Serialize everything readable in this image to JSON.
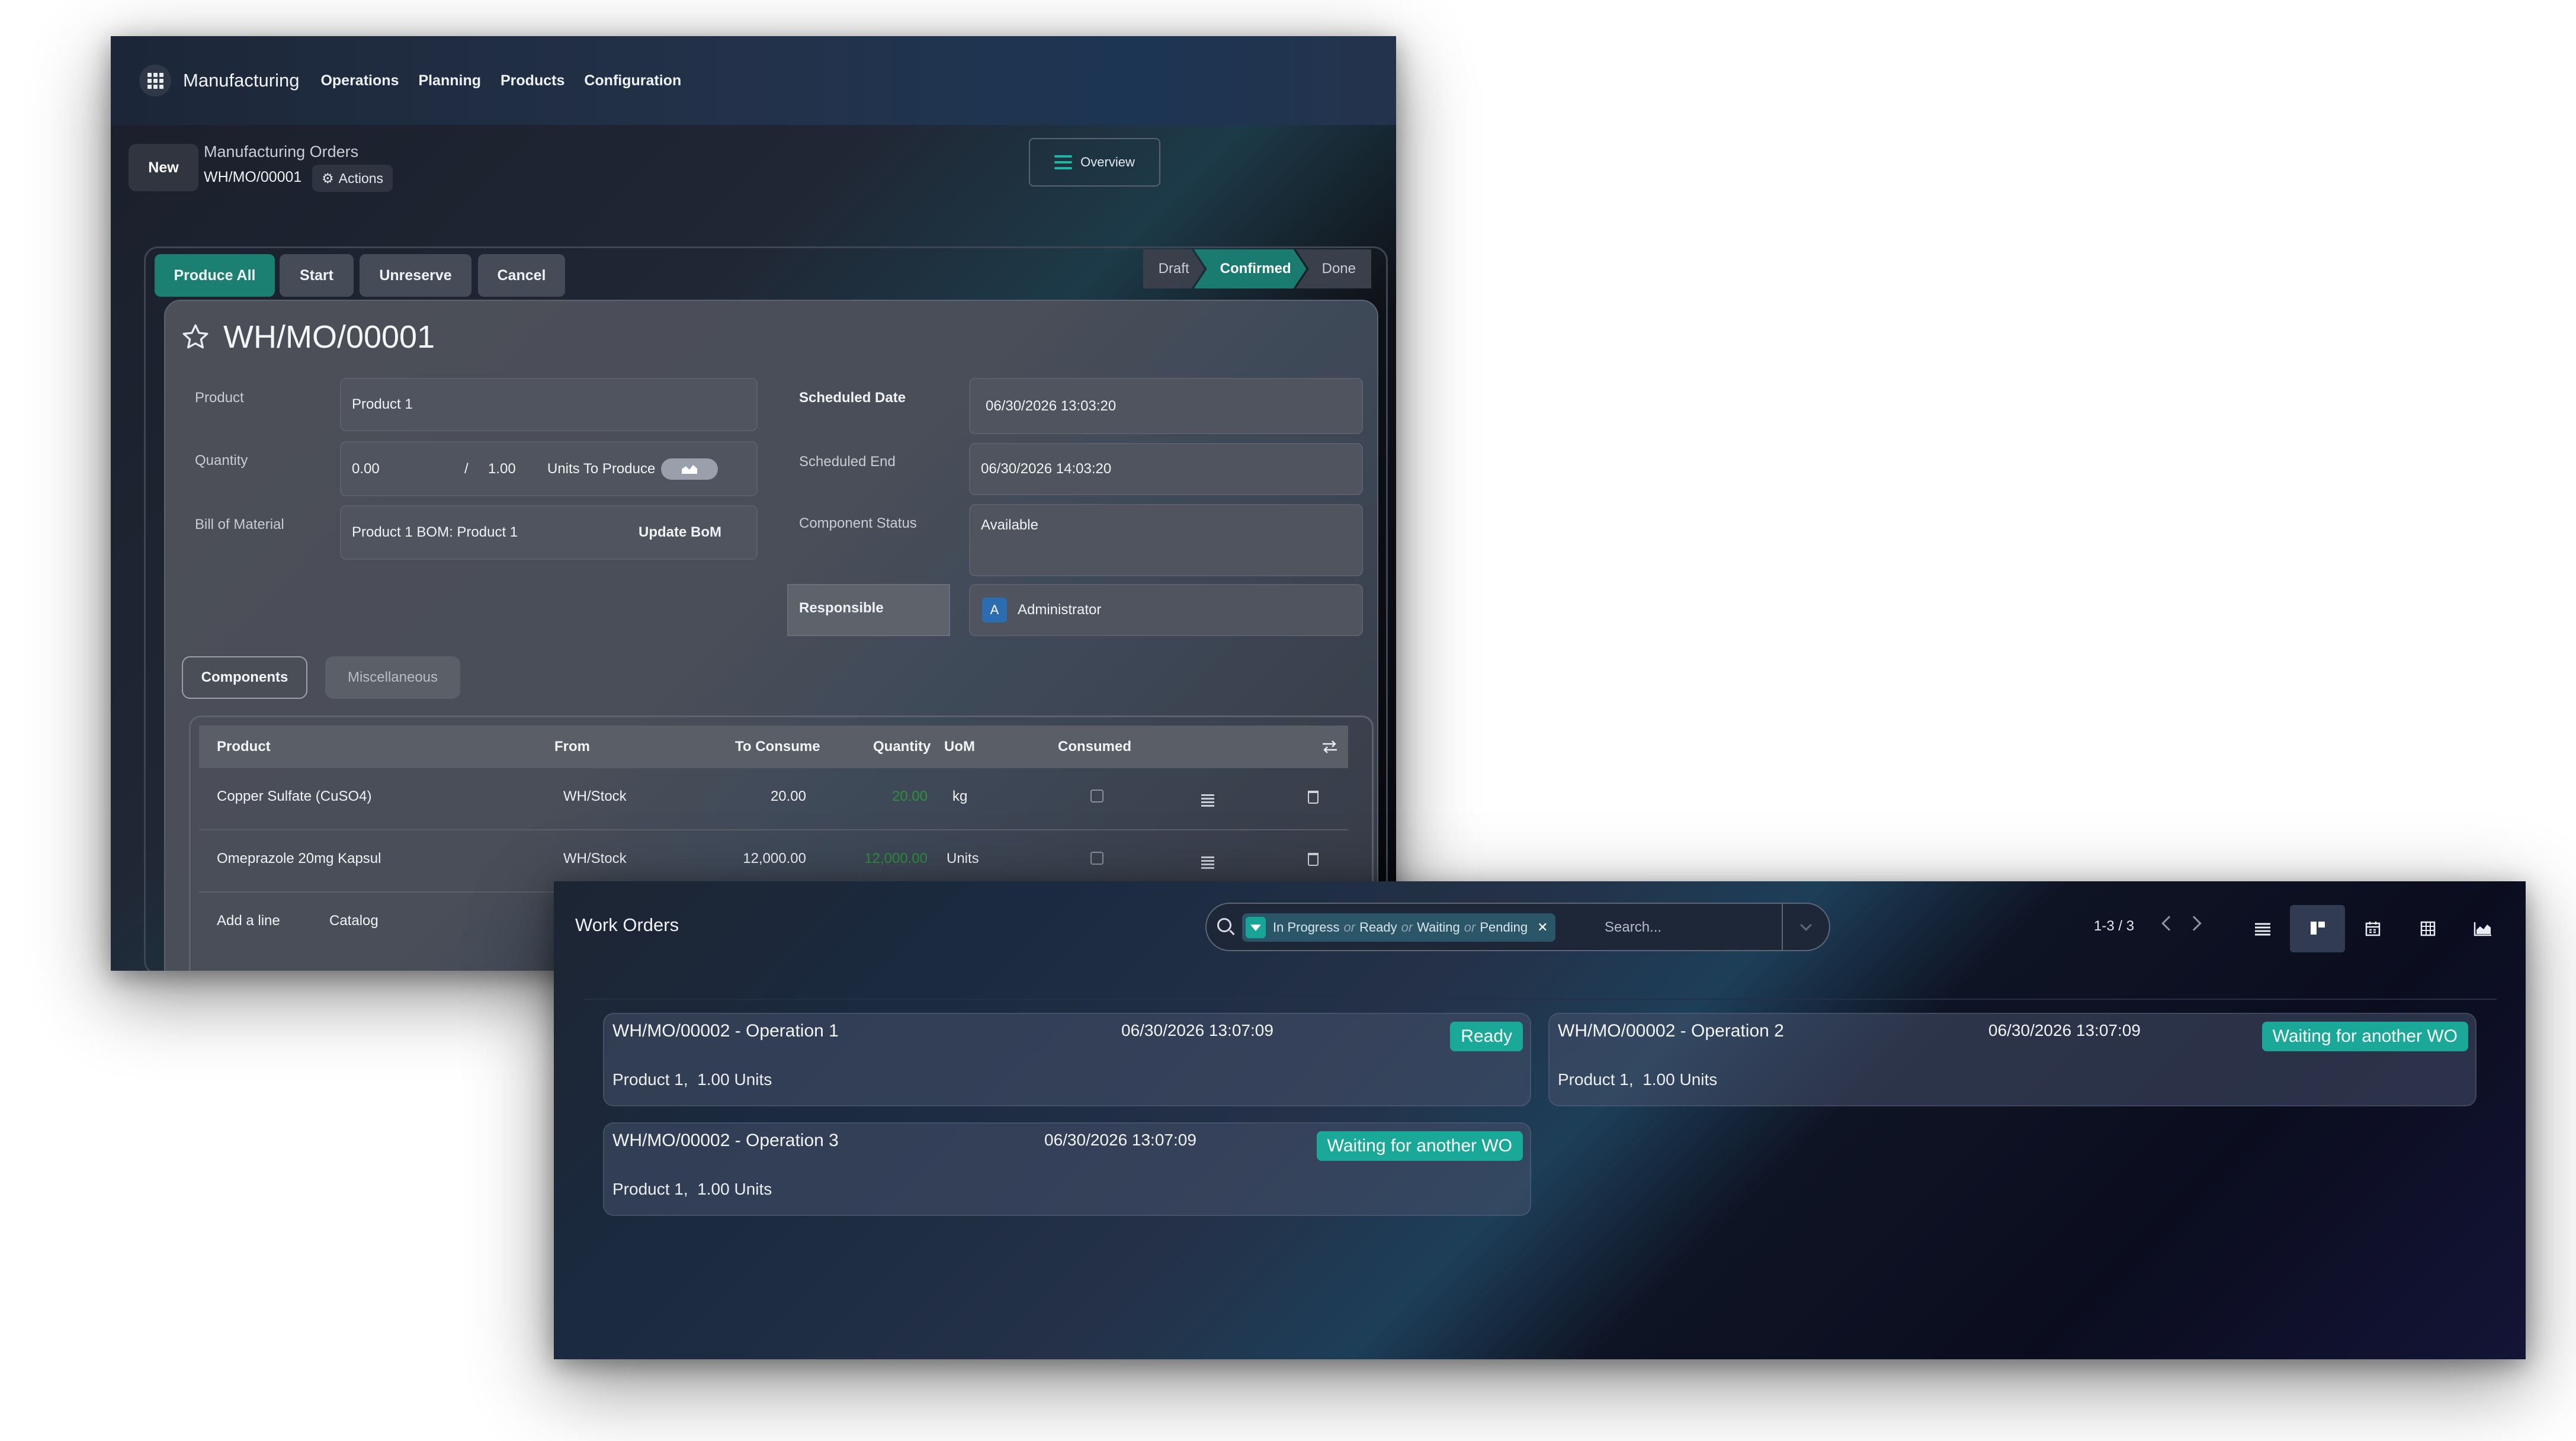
{
  "manufacturing": {
    "topbar": {
      "app_name": "Manufacturing",
      "nav": [
        "Operations",
        "Planning",
        "Products",
        "Configuration"
      ]
    },
    "control": {
      "new_label": "New",
      "breadcrumb": "Manufacturing Orders",
      "record": "WH/MO/00001",
      "actions_label": "Actions",
      "overview_label": "Overview"
    },
    "status_buttons": [
      "Produce All",
      "Start",
      "Unreserve",
      "Cancel"
    ],
    "stages": [
      "Draft",
      "Confirmed",
      "Done"
    ],
    "active_stage": "Confirmed",
    "title": "WH/MO/00001",
    "fields": {
      "product_label": "Product",
      "product_value": "Product 1",
      "quantity_label": "Quantity",
      "quantity_done": "0.00",
      "quantity_sep": "/",
      "quantity_total": "1.00",
      "quantity_unit": "Units To Produce",
      "bom_label": "Bill of Material",
      "bom_value": "Product 1 BOM: Product 1",
      "update_bom_label": "Update BoM",
      "scheduled_date_label": "Scheduled Date",
      "scheduled_date_value": "06/30/2026 13:03:20",
      "scheduled_end_label": "Scheduled End",
      "scheduled_end_value": "06/30/2026 14:03:20",
      "component_status_label": "Component Status",
      "component_status_value": "Available",
      "responsible_label": "Responsible",
      "responsible_value": "Administrator",
      "responsible_initial": "A"
    },
    "tabs": [
      "Components",
      "Miscellaneous"
    ],
    "components_table": {
      "columns": [
        "Product",
        "From",
        "To Consume",
        "Quantity",
        "UoM",
        "Consumed"
      ],
      "rows": [
        {
          "product": "Copper Sulfate (CuSO4)",
          "from": "WH/Stock",
          "to_consume": "20.00",
          "quantity": "20.00",
          "uom": "kg"
        },
        {
          "product": "Omeprazole 20mg Kapsul",
          "from": "WH/Stock",
          "to_consume": "12,000.00",
          "quantity": "12,000.00",
          "uom": "Units"
        }
      ],
      "add_line_label": "Add a line",
      "catalog_label": "Catalog"
    }
  },
  "work_orders": {
    "title": "Work Orders",
    "search": {
      "facet_parts": [
        "In Progress",
        "or",
        "Ready",
        "or",
        "Waiting",
        "or",
        "Pending"
      ],
      "placeholder": "Search..."
    },
    "pager": "1-3 / 3",
    "views": [
      "list-icon",
      "kanban-icon",
      "calendar-icon",
      "pivot-icon",
      "graph-icon"
    ],
    "active_view": "kanban",
    "cards": [
      {
        "title": "WH/MO/00002 - Operation 1",
        "date": "06/30/2026 13:07:09",
        "status": "Ready",
        "product": "Product 1,",
        "qty": "1.00 Units"
      },
      {
        "title": "WH/MO/00002 - Operation 2",
        "date": "06/30/2026 13:07:09",
        "status": "Waiting for another WO",
        "product": "Product 1,",
        "qty": "1.00 Units"
      },
      {
        "title": "WH/MO/00002 - Operation 3",
        "date": "06/30/2026 13:07:09",
        "status": "Waiting for another WO",
        "product": "Product 1,",
        "qty": "1.00 Units"
      }
    ],
    "accent_color": "#1aa998"
  }
}
